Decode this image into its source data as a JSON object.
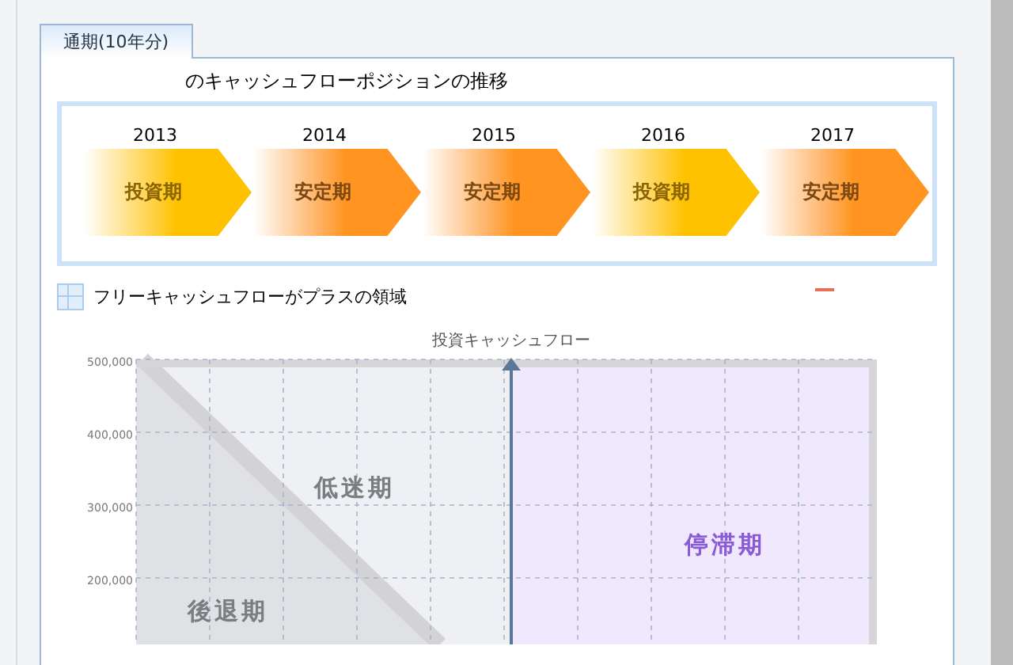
{
  "tabs": [
    {
      "label": "通期(10年分)",
      "selected": true
    }
  ],
  "title": "のキャッシュフローポジションの推移",
  "steps": [
    {
      "year": "2013",
      "label": "投資期",
      "kind": "invest"
    },
    {
      "year": "2014",
      "label": "安定期",
      "kind": "stable"
    },
    {
      "year": "2015",
      "label": "安定期",
      "kind": "stable"
    },
    {
      "year": "2016",
      "label": "投資期",
      "kind": "invest"
    },
    {
      "year": "2017",
      "label": "安定期",
      "kind": "stable"
    }
  ],
  "section": {
    "title": "フリーキャッシュフローがプラスの領域"
  },
  "chart": {
    "axis_label": "投資キャッシュフロー",
    "y_tick_labels": [
      "500,000",
      "400,000",
      "300,000",
      "200,000"
    ],
    "regions": [
      {
        "label": "低迷期",
        "kind": "grey"
      },
      {
        "label": "停滞期",
        "kind": "purple"
      },
      {
        "label": "後退期",
        "kind": "grey"
      }
    ]
  }
}
